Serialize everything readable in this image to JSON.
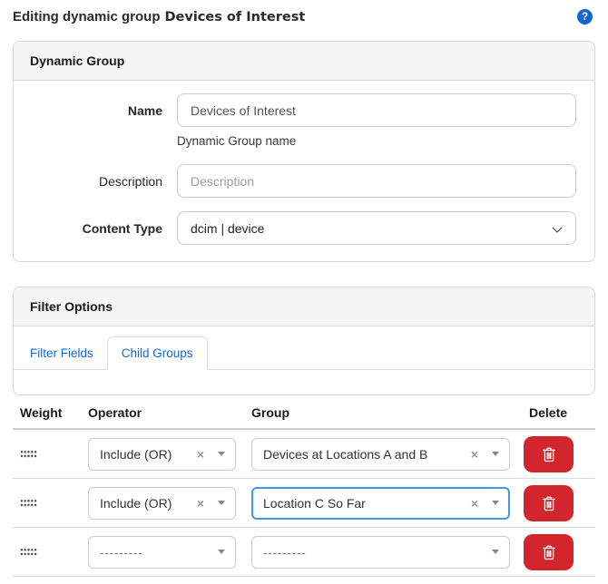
{
  "page": {
    "title_prefix": "Editing dynamic group",
    "title_object": "Devices of Interest",
    "help_glyph": "?"
  },
  "colors": {
    "accent_blue": "#1266d1",
    "tab_link_blue": "#1068d9",
    "focus_border_blue": "#3f97e8",
    "danger_red": "#d2262c",
    "panel_header_bg": "#f5f5f5",
    "panel_border": "#d8d8d8"
  },
  "dynamic_group_panel": {
    "title": "Dynamic Group",
    "fields": {
      "name": {
        "label": "Name",
        "value": "Devices of Interest",
        "help": "Dynamic Group name"
      },
      "description": {
        "label": "Description",
        "value": "",
        "placeholder": "Description"
      },
      "content_type": {
        "label": "Content Type",
        "selected": "dcim | device"
      }
    }
  },
  "filter_options_panel": {
    "title": "Filter Options",
    "tabs": [
      {
        "label": "Filter Fields",
        "active": false
      },
      {
        "label": "Child Groups",
        "active": true
      }
    ]
  },
  "child_groups_table": {
    "columns": [
      "Weight",
      "Operator",
      "Group",
      "Delete"
    ],
    "clear_glyph": "×",
    "empty_value": "---------",
    "rows": [
      {
        "operator": "Include (OR)",
        "group": "Devices at Locations A and B"
      },
      {
        "operator": "Include (OR)",
        "group": "Location C So Far"
      },
      {
        "operator": "---------",
        "group": "---------"
      }
    ]
  }
}
